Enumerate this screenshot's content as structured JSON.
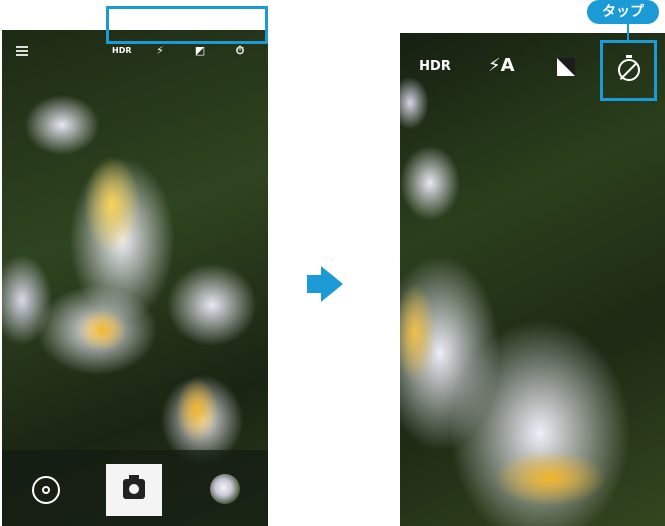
{
  "left_screen": {
    "toolbar": {
      "hdr_label": "HDR",
      "flash_label": "⚡",
      "exposure_label": "◩",
      "timer_label": "⏱"
    }
  },
  "right_screen": {
    "toolbar": {
      "hdr_label": "HDR",
      "flash_label": "⚡A",
      "exposure_label": "",
      "timer_label": ""
    }
  },
  "callout": {
    "tap_label": "タップ"
  },
  "colors": {
    "accent": "#1b9ad6"
  },
  "icons": [
    "menu-icon",
    "hdr-icon",
    "flash-auto-icon",
    "exposure-icon",
    "timer-icon",
    "rotate-camera-icon",
    "shutter-camera-icon",
    "gallery-thumbnail",
    "arrow-right-icon"
  ]
}
